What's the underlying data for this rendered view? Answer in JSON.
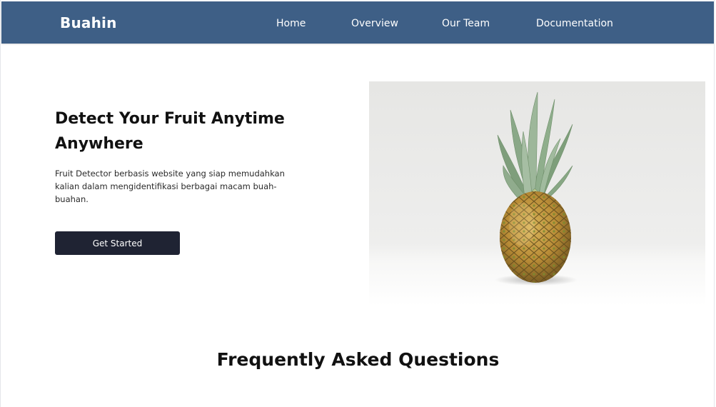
{
  "navbar": {
    "brand": "Buahin",
    "links": [
      {
        "label": "Home"
      },
      {
        "label": "Overview"
      },
      {
        "label": "Our Team"
      },
      {
        "label": "Documentation"
      }
    ],
    "background_color": "#3e5f86"
  },
  "hero": {
    "title": "Detect Your Fruit Anytime Anywhere",
    "description": "Fruit Detector berbasis website yang siap memudahkan kalian dalam mengidentifikasi berbagai macam buah-buahan.",
    "cta_label": "Get Started",
    "cta_color": "#1f2333",
    "image_subject": "pineapple-photo"
  },
  "faq": {
    "title": "Frequently Asked Questions"
  }
}
